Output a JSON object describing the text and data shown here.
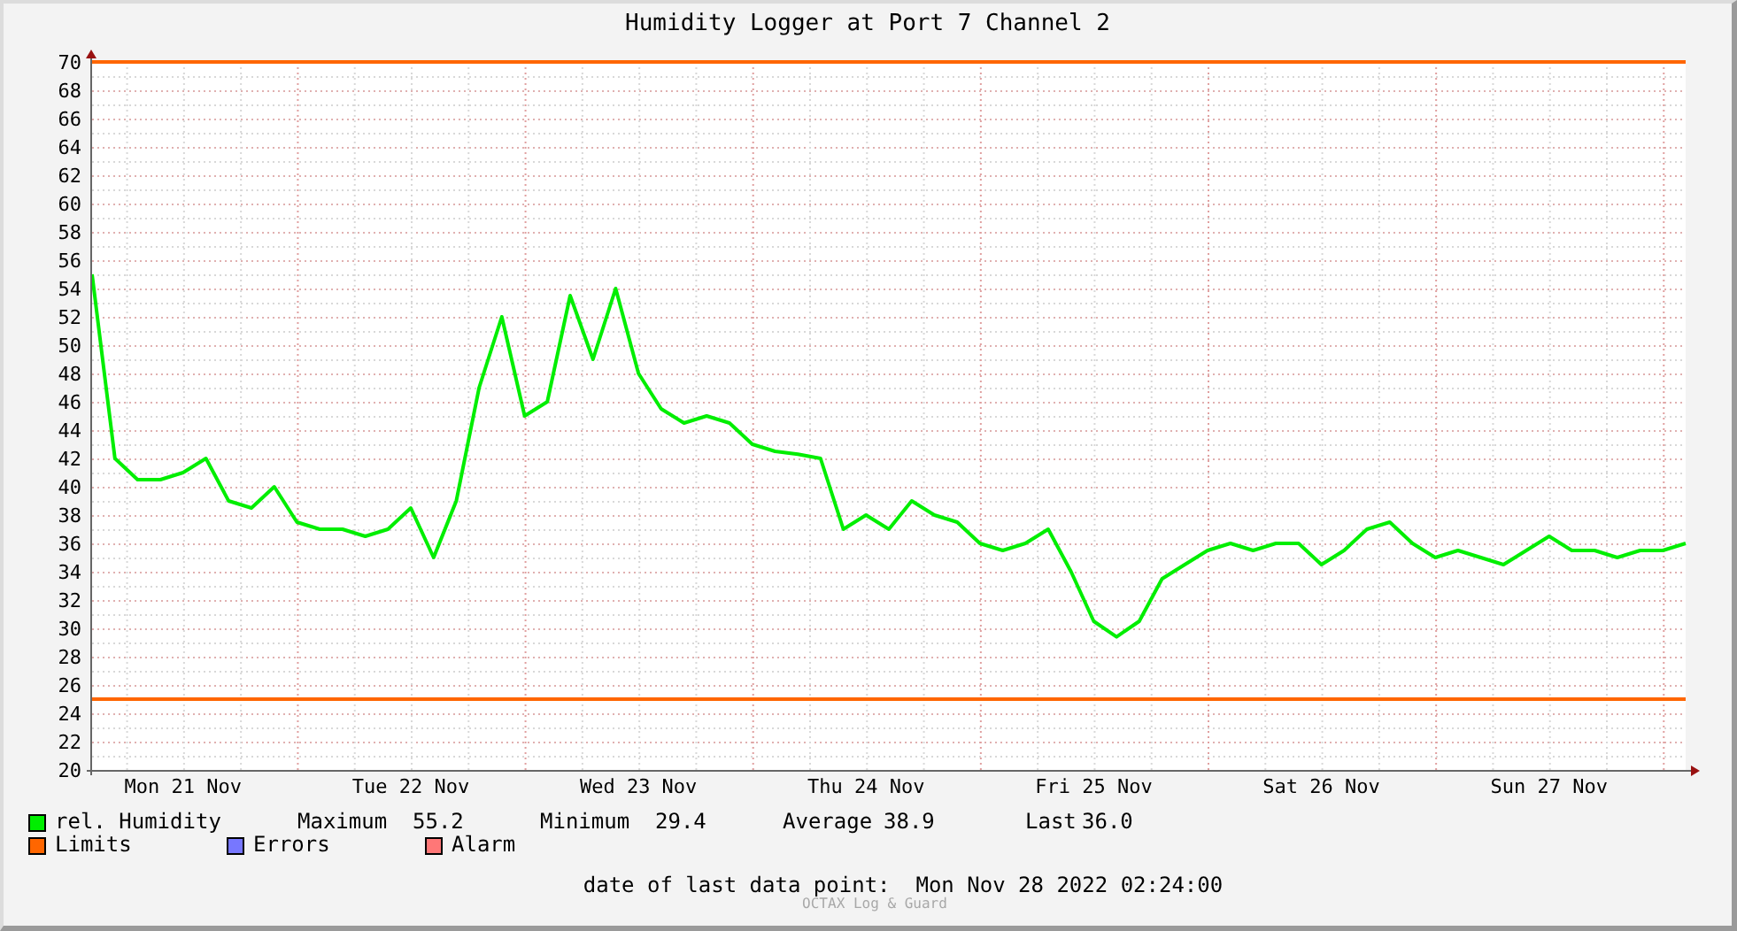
{
  "chart_data": {
    "type": "line",
    "title": "Humidity Logger at Port 7 Channel 2",
    "categories": [
      null,
      null,
      null,
      null,
      "Mon 21 Nov",
      null,
      null,
      null,
      null,
      null,
      null,
      null,
      null,
      null,
      "Tue 22 Nov",
      null,
      null,
      null,
      null,
      null,
      null,
      null,
      null,
      null,
      "Wed 23 Nov",
      null,
      null,
      null,
      null,
      null,
      null,
      null,
      null,
      null,
      "Thu 24 Nov",
      null,
      null,
      null,
      null,
      null,
      null,
      null,
      null,
      null,
      "Fri 25 Nov",
      null,
      null,
      null,
      null,
      null,
      null,
      null,
      null,
      null,
      "Sat 26 Nov",
      null,
      null,
      null,
      null,
      null,
      null,
      null,
      null,
      null,
      "Sun 27 Nov",
      null,
      null,
      null,
      null,
      null,
      null
    ],
    "series": [
      {
        "name": "rel. Humidity",
        "color": "#00ee00",
        "values": [
          55,
          42,
          40.5,
          40.5,
          41,
          42,
          39,
          38.5,
          40,
          37.5,
          37,
          37,
          36.5,
          37,
          38.5,
          35,
          39,
          47,
          52,
          45,
          46,
          53.5,
          49,
          54,
          48,
          45.5,
          44.5,
          45,
          44.5,
          43,
          42.5,
          42.3,
          42,
          37,
          38,
          37,
          39,
          38,
          37.5,
          36,
          35.5,
          36,
          37,
          34,
          30.5,
          29.4,
          30.5,
          33.5,
          34.5,
          35.5,
          36,
          35.5,
          36,
          36,
          34.5,
          35.5,
          37,
          37.5,
          36,
          35,
          35.5,
          35,
          34.5,
          35.5,
          36.5,
          35.5,
          35.5,
          35,
          35.5,
          35.5,
          36
        ]
      }
    ],
    "ylim": [
      20,
      70
    ],
    "grid": true,
    "yticks": [
      20,
      22,
      24,
      26,
      28,
      30,
      32,
      34,
      36,
      38,
      40,
      42,
      44,
      46,
      48,
      50,
      52,
      54,
      56,
      58,
      60,
      62,
      64,
      66,
      68,
      70
    ],
    "ref_lines": [
      {
        "axis": "y",
        "value": 70
      },
      {
        "axis": "y",
        "value": 25
      }
    ]
  },
  "legend": [
    {
      "stats": [
        {
          "label": "Maximum",
          "value": "55.2"
        },
        {
          "label": "Minimum",
          "value": "29.4"
        },
        {
          "label": "Average",
          "value": "38.9"
        },
        {
          "label": "Last",
          "value": "36.0"
        }
      ]
    },
    {
      "label": "Limits",
      "color": "#ff6600"
    },
    {
      "label": "Errors",
      "color": "#7777ff"
    },
    {
      "label": "Alarm",
      "color": "#ff7777"
    }
  ],
  "footer": {
    "label": "date of last data point:",
    "value": "Mon Nov 28 2022 02:24:00"
  },
  "watermark": "OCTAX Log & Guard"
}
